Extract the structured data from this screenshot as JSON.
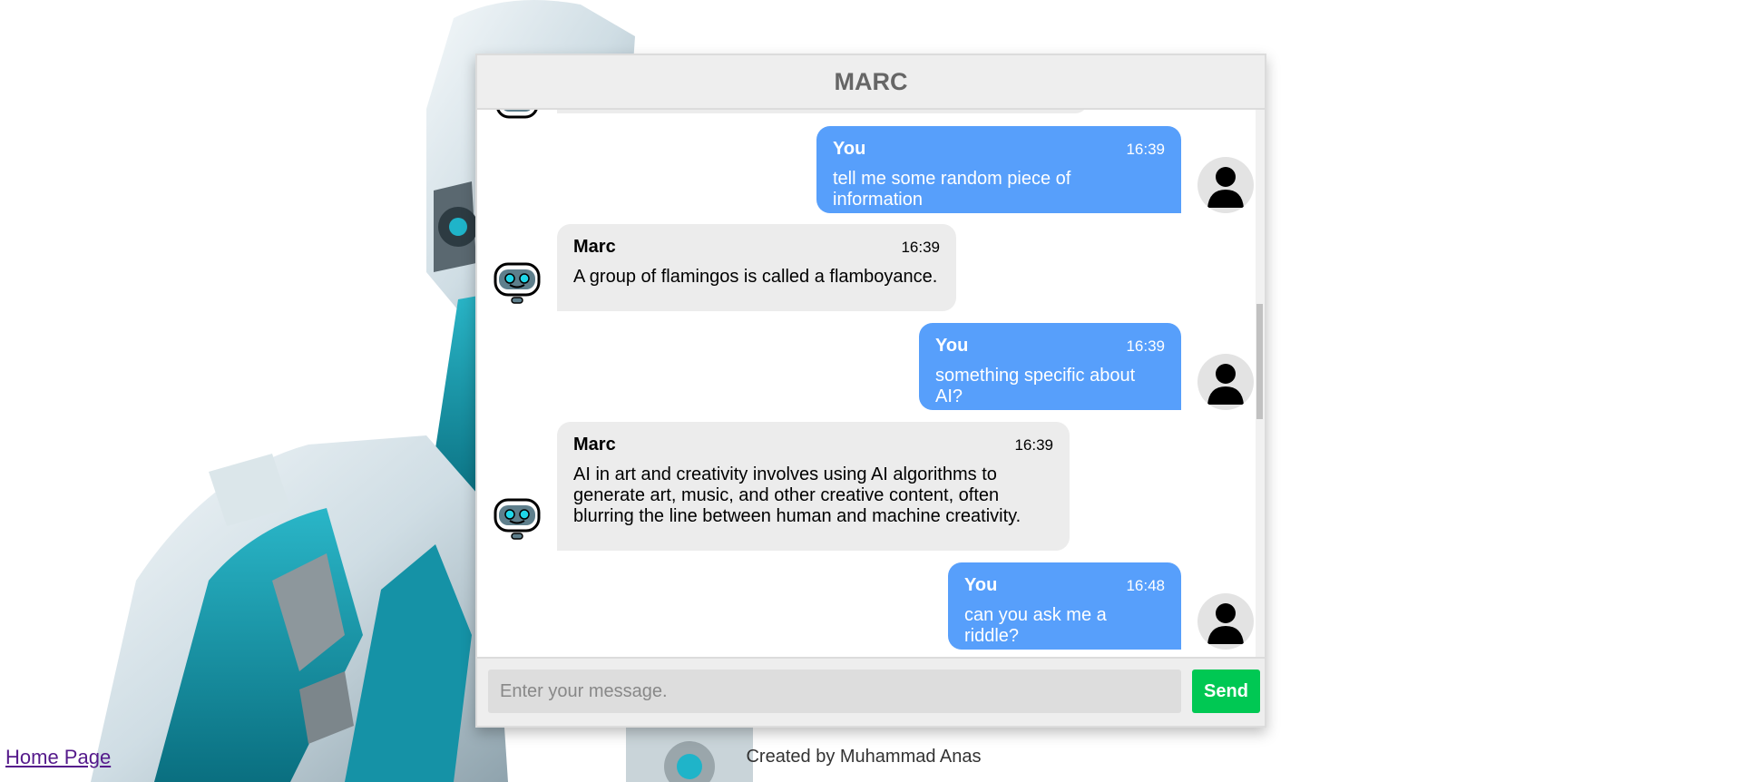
{
  "header": {
    "title": "MARC"
  },
  "messages": [
    {
      "sender": "You",
      "time": "16:39",
      "text": "tell me some random piece of information",
      "side": "user"
    },
    {
      "sender": "Marc",
      "time": "16:39",
      "text": "A group of flamingos is called a flamboyance.",
      "side": "bot"
    },
    {
      "sender": "You",
      "time": "16:39",
      "text": "something specific about AI?",
      "side": "user"
    },
    {
      "sender": "Marc",
      "time": "16:39",
      "text": "AI in art and creativity involves using AI algorithms to generate art, music, and other creative content, often blurring the line between human and machine creativity.",
      "side": "bot"
    },
    {
      "sender": "You",
      "time": "16:48",
      "text": "can you ask me a riddle?",
      "side": "user"
    }
  ],
  "input": {
    "placeholder": "Enter your message.",
    "value": ""
  },
  "send_button": {
    "label": "Send"
  },
  "footer": {
    "home_link": "Home Page",
    "credit": "Created by Muhammad Anas"
  },
  "colors": {
    "user_bubble": "#579ffb",
    "bot_bubble": "#ececec",
    "send_button": "#00c853",
    "header_bg": "#eeeeee"
  },
  "icons": {
    "user_avatar": "user-silhouette-icon",
    "bot_avatar": "robot-face-icon"
  }
}
